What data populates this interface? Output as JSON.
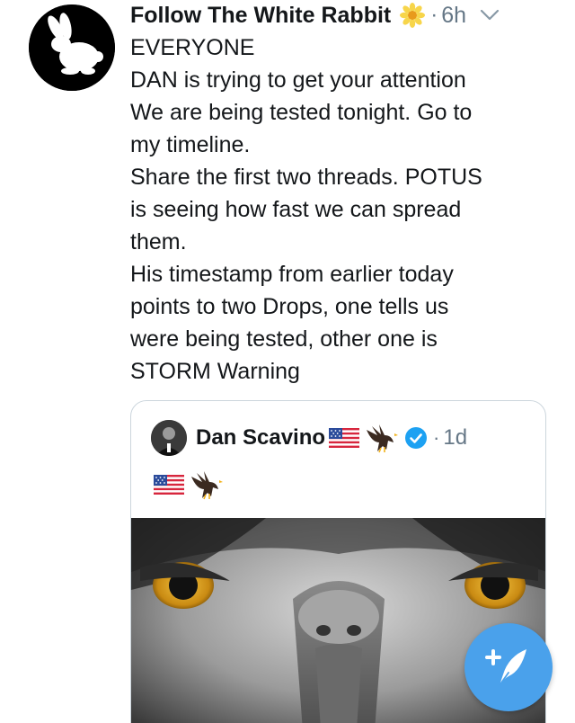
{
  "tweet": {
    "author": {
      "display_name": "Follow The White Rabbit",
      "avatar_icon": "white-rabbit-icon",
      "name_emoji": "sunflower-emoji"
    },
    "separator": "·",
    "timestamp": "6h",
    "menu_icon": "chevron-down-icon",
    "text_lines": [
      "EVERYONE",
      "DAN is trying to get your attention",
      "We are being tested tonight. Go to",
      "my timeline.",
      "Share the first two threads. POTUS",
      "is seeing how fast we can spread",
      "them.",
      "His timestamp from earlier today",
      "points to two Drops, one tells us",
      "were being tested, other one is",
      "STORM Warning"
    ]
  },
  "quoted_tweet": {
    "author": {
      "display_name": "Dan Scavino",
      "name_emojis": [
        "us-flag-emoji",
        "eagle-emoji"
      ],
      "verified": true
    },
    "separator": "·",
    "timestamp": "1d",
    "body_emojis": [
      "us-flag-emoji",
      "eagle-emoji"
    ],
    "media": "eagle-closeup-photo"
  },
  "compose_button": {
    "icon": "compose-feather-icon"
  },
  "colors": {
    "text": "#14171a",
    "muted": "#657786",
    "border": "#ccd6dd",
    "accent": "#4aa1eb",
    "verified": "#1da1f2"
  }
}
